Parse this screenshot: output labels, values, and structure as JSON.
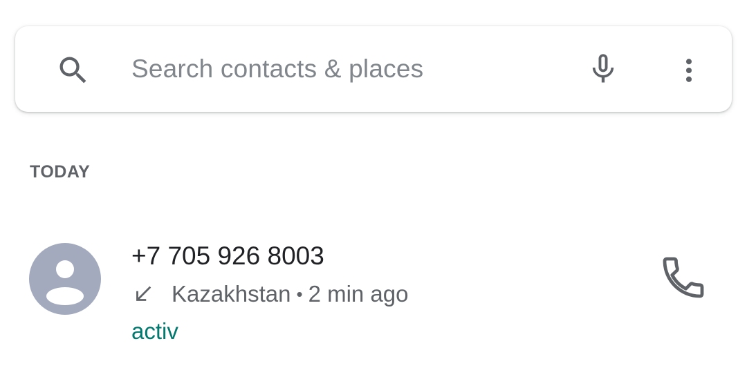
{
  "search": {
    "placeholder": "Search contacts & places",
    "icons": {
      "search": "search-icon",
      "mic": "mic-icon",
      "menu": "more-vert-icon"
    }
  },
  "sections": [
    {
      "header": "TODAY",
      "calls": [
        {
          "number": "+7 705 926 8003",
          "direction_icon": "call-received-icon",
          "location": "Kazakhstan",
          "separator": "•",
          "time": "2 min ago",
          "carrier": "activ",
          "avatar_icon": "person-icon",
          "action_icon": "phone-icon"
        }
      ]
    }
  ],
  "colors": {
    "placeholder": "#80868b",
    "icon": "#5f6368",
    "primary_text": "#202124",
    "secondary_text": "#5f6368",
    "carrier_text": "#01796f",
    "avatar_bg": "#a4aabd"
  }
}
